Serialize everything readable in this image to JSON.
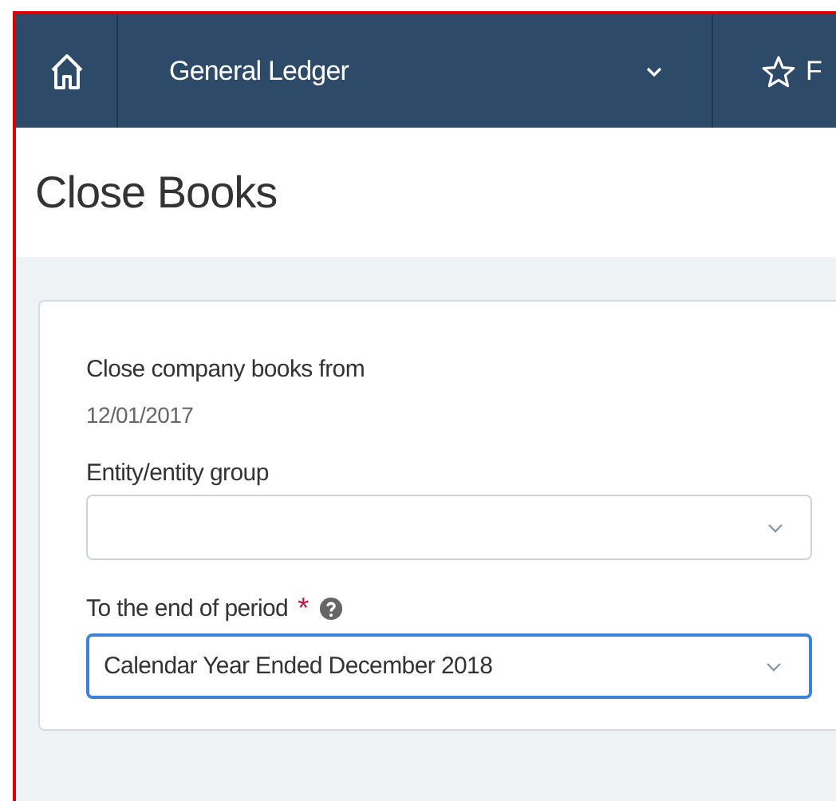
{
  "nav": {
    "module": "General Ledger",
    "favorites": "F"
  },
  "title": "Close Books",
  "form": {
    "from_label": "Close company books from",
    "from_value": "12/01/2017",
    "fields": [
      {
        "label": "Entity/entity group",
        "help": false,
        "focused": false
      },
      {
        "label": "To the end of period",
        "required_mark": "*",
        "value": "Calendar Year Ended December 2018",
        "help": true,
        "focused": true
      }
    ]
  }
}
